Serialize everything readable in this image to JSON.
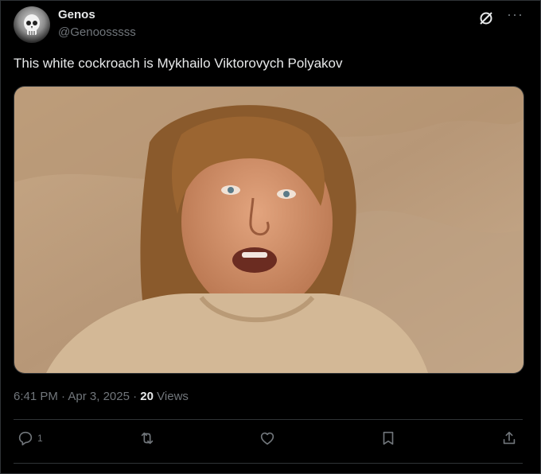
{
  "post": {
    "author_name": "Genos",
    "author_handle": "@Genoosssss",
    "text": "This white cockroach is Mykhailo Viktorovych Polyakov",
    "time": "6:41 PM",
    "date": "Apr 3, 2025",
    "views_count": "20",
    "views_label": "Views",
    "reply_count": "1"
  },
  "icons": {
    "avatar": "skull-avatar",
    "grok": "grok-icon",
    "more": "more-icon",
    "reply": "reply-icon",
    "repost": "repost-icon",
    "like": "like-icon",
    "bookmark": "bookmark-icon",
    "share": "share-icon"
  },
  "colors": {
    "background": "#000000",
    "text_primary": "#e7e9ea",
    "text_secondary": "#71767b",
    "border": "#2f3336"
  }
}
